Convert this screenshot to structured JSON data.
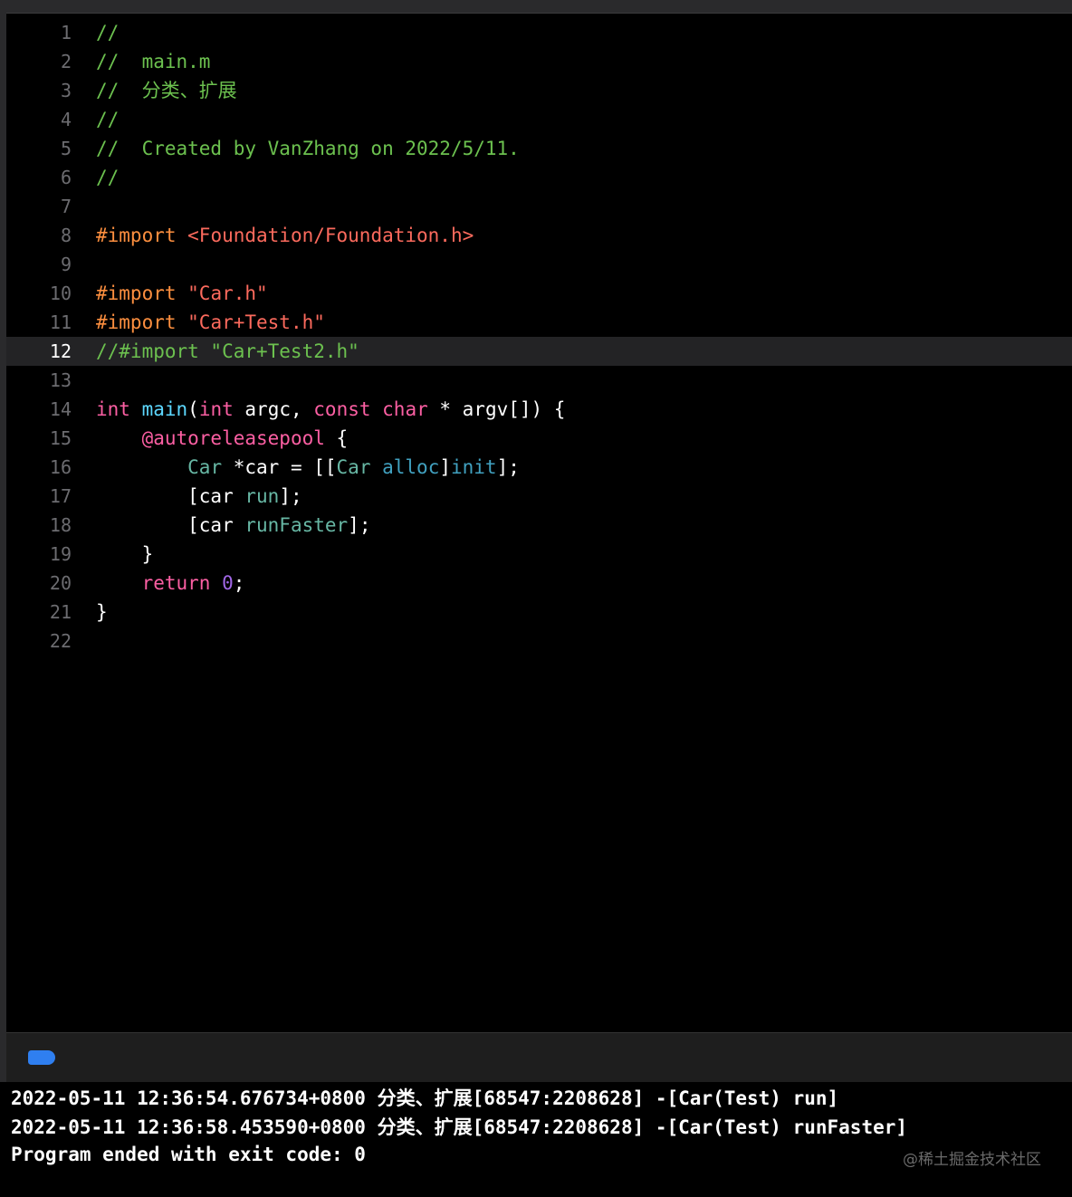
{
  "editor": {
    "current_line": "12",
    "lines": [
      {
        "num": "1",
        "tokens": [
          {
            "t": "//",
            "c": "comment"
          }
        ]
      },
      {
        "num": "2",
        "tokens": [
          {
            "t": "//  main.m",
            "c": "comment"
          }
        ]
      },
      {
        "num": "3",
        "tokens": [
          {
            "t": "//  分类、扩展",
            "c": "comment"
          }
        ]
      },
      {
        "num": "4",
        "tokens": [
          {
            "t": "//",
            "c": "comment"
          }
        ]
      },
      {
        "num": "5",
        "tokens": [
          {
            "t": "//  Created by VanZhang on 2022/5/11.",
            "c": "comment"
          }
        ]
      },
      {
        "num": "6",
        "tokens": [
          {
            "t": "//",
            "c": "comment"
          }
        ]
      },
      {
        "num": "7",
        "tokens": []
      },
      {
        "num": "8",
        "tokens": [
          {
            "t": "#import ",
            "c": "preproc"
          },
          {
            "t": "<Foundation/Foundation.h>",
            "c": "include"
          }
        ]
      },
      {
        "num": "9",
        "tokens": []
      },
      {
        "num": "10",
        "tokens": [
          {
            "t": "#import ",
            "c": "preproc"
          },
          {
            "t": "\"Car.h\"",
            "c": "string"
          }
        ]
      },
      {
        "num": "11",
        "tokens": [
          {
            "t": "#import ",
            "c": "preproc"
          },
          {
            "t": "\"Car+Test.h\"",
            "c": "string"
          }
        ]
      },
      {
        "num": "12",
        "tokens": [
          {
            "t": "//#import \"Car+Test2.h\"",
            "c": "comment"
          }
        ]
      },
      {
        "num": "13",
        "tokens": []
      },
      {
        "num": "14",
        "tokens": [
          {
            "t": "int",
            "c": "keyword"
          },
          {
            "t": " ",
            "c": "plain"
          },
          {
            "t": "main",
            "c": "type"
          },
          {
            "t": "(",
            "c": "plain"
          },
          {
            "t": "int",
            "c": "keyword"
          },
          {
            "t": " argc, ",
            "c": "plain"
          },
          {
            "t": "const",
            "c": "keyword"
          },
          {
            "t": " ",
            "c": "plain"
          },
          {
            "t": "char",
            "c": "keyword"
          },
          {
            "t": " * argv[]) {",
            "c": "plain"
          }
        ]
      },
      {
        "num": "15",
        "tokens": [
          {
            "t": "    ",
            "c": "plain"
          },
          {
            "t": "@autoreleasepool",
            "c": "at"
          },
          {
            "t": " {",
            "c": "plain"
          }
        ]
      },
      {
        "num": "16",
        "tokens": [
          {
            "t": "        ",
            "c": "plain"
          },
          {
            "t": "Car",
            "c": "class"
          },
          {
            "t": " *car = [[",
            "c": "plain"
          },
          {
            "t": "Car",
            "c": "class"
          },
          {
            "t": " ",
            "c": "plain"
          },
          {
            "t": "alloc",
            "c": "method"
          },
          {
            "t": "]",
            "c": "plain"
          },
          {
            "t": "init",
            "c": "method"
          },
          {
            "t": "];",
            "c": "plain"
          }
        ]
      },
      {
        "num": "17",
        "tokens": [
          {
            "t": "        [car ",
            "c": "plain"
          },
          {
            "t": "run",
            "c": "method2"
          },
          {
            "t": "];",
            "c": "plain"
          }
        ]
      },
      {
        "num": "18",
        "tokens": [
          {
            "t": "        [car ",
            "c": "plain"
          },
          {
            "t": "runFaster",
            "c": "method2"
          },
          {
            "t": "];",
            "c": "plain"
          }
        ]
      },
      {
        "num": "19",
        "tokens": [
          {
            "t": "    }",
            "c": "plain"
          }
        ]
      },
      {
        "num": "20",
        "tokens": [
          {
            "t": "    ",
            "c": "plain"
          },
          {
            "t": "return",
            "c": "keyword"
          },
          {
            "t": " ",
            "c": "plain"
          },
          {
            "t": "0",
            "c": "num"
          },
          {
            "t": ";",
            "c": "plain"
          }
        ]
      },
      {
        "num": "21",
        "tokens": [
          {
            "t": "}",
            "c": "plain"
          }
        ]
      },
      {
        "num": "22",
        "tokens": []
      }
    ]
  },
  "console_bar": {
    "filter_icon": "filter-tag-icon",
    "filter_icon_color": "#2f7ff0"
  },
  "console": {
    "lines": [
      "2022-05-11 12:36:54.676734+0800 分类、扩展[68547:2208628] -[Car(Test) run]",
      "2022-05-11 12:36:58.453590+0800 分类、扩展[68547:2208628] -[Car(Test) runFaster]",
      "Program ended with exit code: 0"
    ]
  },
  "watermark": "@稀土掘金技术社区"
}
